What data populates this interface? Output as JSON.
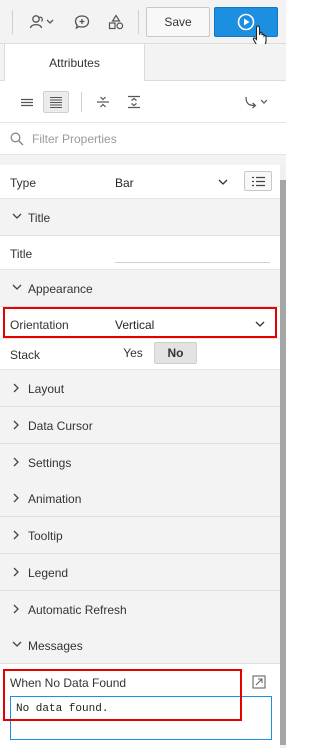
{
  "toolbar": {
    "save_label": "Save",
    "icons": [
      "shared-components-icon",
      "comments-icon",
      "shapes-icon",
      "run-page-icon"
    ]
  },
  "tabs": {
    "active": "Attributes"
  },
  "filter": {
    "placeholder": "Filter Properties"
  },
  "properties": {
    "type": {
      "label": "Type",
      "value": "Bar"
    },
    "title_section": "Title",
    "title_field": {
      "label": "Title",
      "value": ""
    },
    "appearance_section": "Appearance",
    "orientation": {
      "label": "Orientation",
      "value": "Vertical"
    },
    "stack": {
      "label": "Stack",
      "yes": "Yes",
      "no": "No",
      "selected": "No"
    },
    "collapsed_sections": [
      "Layout",
      "Data Cursor",
      "Settings",
      "Animation",
      "Tooltip",
      "Legend",
      "Automatic Refresh"
    ],
    "messages_section": "Messages",
    "no_data": {
      "label": "When No Data Found",
      "value": "No data found."
    }
  },
  "colors": {
    "accent": "#1d8fe0",
    "highlight_box": "#e60000",
    "section_bg": "#f3f3f3"
  }
}
